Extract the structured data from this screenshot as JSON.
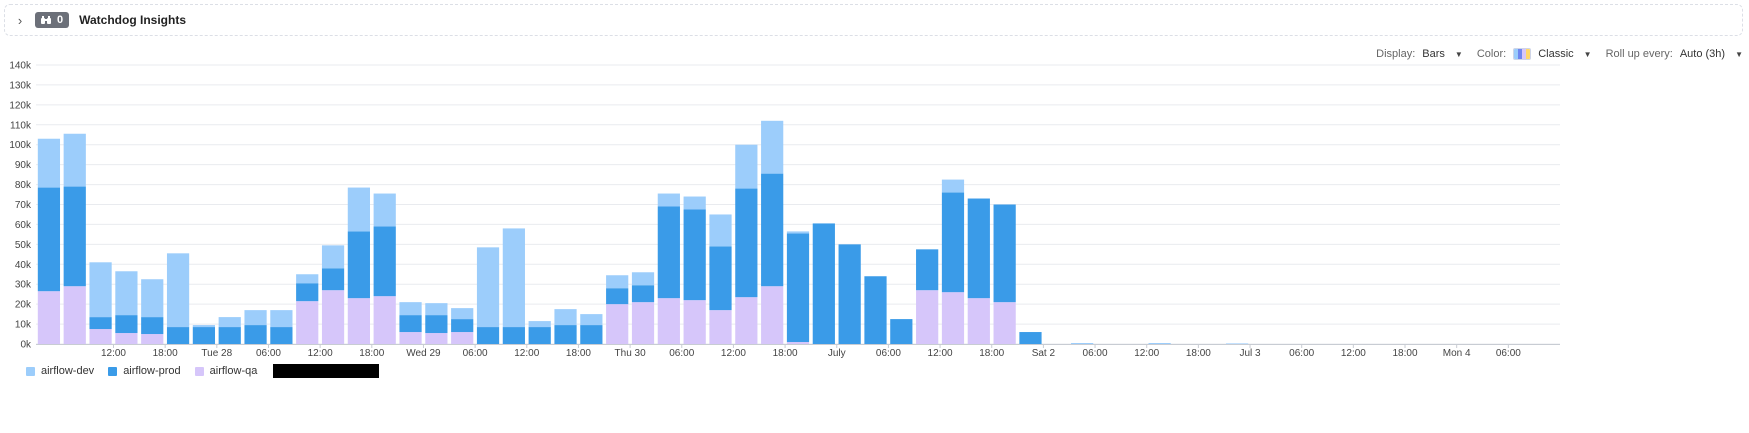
{
  "insights": {
    "count": "0",
    "title": "Watchdog Insights"
  },
  "controls": {
    "display_label": "Display:",
    "display_value": "Bars",
    "color_label": "Color:",
    "color_value": "Classic",
    "rollup_label": "Roll up every:",
    "rollup_value": "Auto (3h)"
  },
  "colors": {
    "airflow-dev": "#9ccdfb",
    "airflow-prod": "#3a9be8",
    "airflow-qa": "#d6c6fa"
  },
  "chart_data": {
    "type": "bar",
    "stacked": true,
    "ylim": [
      0,
      140000
    ],
    "yticks": [
      0,
      10000,
      20000,
      30000,
      40000,
      50000,
      60000,
      70000,
      80000,
      90000,
      100000,
      110000,
      120000,
      130000,
      140000
    ],
    "ytick_labels": [
      "0k",
      "10k",
      "20k",
      "30k",
      "40k",
      "50k",
      "60k",
      "70k",
      "80k",
      "90k",
      "100k",
      "110k",
      "120k",
      "130k",
      "140k"
    ],
    "xlim": [
      "Jun 27 03:00",
      "Jul 4 12:00"
    ],
    "xticks": [
      {
        "x": "Jun 27 12:00",
        "label": "12:00"
      },
      {
        "x": "Jun 27 18:00",
        "label": "18:00"
      },
      {
        "x": "Jun 28 00:00",
        "label": "Tue 28"
      },
      {
        "x": "Jun 28 06:00",
        "label": "06:00"
      },
      {
        "x": "Jun 28 12:00",
        "label": "12:00"
      },
      {
        "x": "Jun 28 18:00",
        "label": "18:00"
      },
      {
        "x": "Jun 29 00:00",
        "label": "Wed 29"
      },
      {
        "x": "Jun 29 06:00",
        "label": "06:00"
      },
      {
        "x": "Jun 29 12:00",
        "label": "12:00"
      },
      {
        "x": "Jun 29 18:00",
        "label": "18:00"
      },
      {
        "x": "Jun 30 00:00",
        "label": "Thu 30"
      },
      {
        "x": "Jun 30 06:00",
        "label": "06:00"
      },
      {
        "x": "Jun 30 12:00",
        "label": "12:00"
      },
      {
        "x": "Jun 30 18:00",
        "label": "18:00"
      },
      {
        "x": "Jul 1 00:00",
        "label": "July"
      },
      {
        "x": "Jul 1 06:00",
        "label": "06:00"
      },
      {
        "x": "Jul 1 12:00",
        "label": "12:00"
      },
      {
        "x": "Jul 1 18:00",
        "label": "18:00"
      },
      {
        "x": "Jul 2 00:00",
        "label": "Sat 2"
      },
      {
        "x": "Jul 2 06:00",
        "label": "06:00"
      },
      {
        "x": "Jul 2 12:00",
        "label": "12:00"
      },
      {
        "x": "Jul 2 18:00",
        "label": "18:00"
      },
      {
        "x": "Jul 3 00:00",
        "label": "Jul 3"
      },
      {
        "x": "Jul 3 06:00",
        "label": "06:00"
      },
      {
        "x": "Jul 3 12:00",
        "label": "12:00"
      },
      {
        "x": "Jul 3 18:00",
        "label": "18:00"
      },
      {
        "x": "Jul 4 00:00",
        "label": "Mon 4"
      },
      {
        "x": "Jul 4 06:00",
        "label": "06:00"
      }
    ],
    "categories": [
      "Jun 27 03:00",
      "Jun 27 06:00",
      "Jun 27 09:00",
      "Jun 27 12:00",
      "Jun 27 15:00",
      "Jun 27 18:00",
      "Jun 27 21:00",
      "Jun 28 00:00",
      "Jun 28 03:00",
      "Jun 28 06:00",
      "Jun 28 09:00",
      "Jun 28 12:00",
      "Jun 28 15:00",
      "Jun 28 18:00",
      "Jun 28 21:00",
      "Jun 29 00:00",
      "Jun 29 03:00",
      "Jun 29 06:00",
      "Jun 29 09:00",
      "Jun 29 12:00",
      "Jun 29 15:00",
      "Jun 29 18:00",
      "Jun 29 21:00",
      "Jun 30 00:00",
      "Jun 30 03:00",
      "Jun 30 06:00",
      "Jun 30 09:00",
      "Jun 30 12:00",
      "Jun 30 15:00",
      "Jun 30 18:00",
      "Jun 30 21:00",
      "Jul 1 00:00",
      "Jul 1 03:00",
      "Jul 1 06:00",
      "Jul 1 09:00",
      "Jul 1 12:00",
      "Jul 1 15:00",
      "Jul 1 18:00",
      "Jul 1 21:00",
      "Jul 2 00:00",
      "Jul 2 03:00",
      "Jul 2 06:00",
      "Jul 2 09:00",
      "Jul 2 12:00",
      "Jul 2 15:00",
      "Jul 2 18:00",
      "Jul 2 21:00",
      "Jul 3 00:00",
      "Jul 3 03:00",
      "Jul 3 06:00",
      "Jul 3 09:00",
      "Jul 3 12:00",
      "Jul 3 15:00",
      "Jul 3 18:00",
      "Jul 3 21:00",
      "Jul 4 00:00",
      "Jul 4 03:00",
      "Jul 4 06:00",
      "Jul 4 09:00"
    ],
    "series": [
      {
        "name": "airflow-qa",
        "values": [
          26500,
          29000,
          7500,
          5500,
          5000,
          0,
          0,
          0,
          0,
          0,
          21500,
          27000,
          23000,
          24000,
          6000,
          5500,
          6000,
          0,
          0,
          0,
          0,
          0,
          20000,
          21000,
          23000,
          22000,
          17000,
          23500,
          29000,
          1000,
          0,
          0,
          0,
          0,
          27000,
          26000,
          23000,
          21000,
          0,
          0,
          0,
          0,
          0,
          0,
          0,
          0,
          0,
          0,
          0,
          0,
          0,
          0,
          0,
          0,
          0,
          0,
          0,
          0,
          0,
          0,
          0,
          0,
          0,
          1500
        ]
      },
      {
        "name": "airflow-prod",
        "values": [
          52000,
          50000,
          6000,
          9000,
          8500,
          8500,
          8500,
          8500,
          9500,
          8500,
          9000,
          11000,
          33500,
          35000,
          8500,
          9000,
          6500,
          8500,
          8500,
          8500,
          9500,
          9500,
          8000,
          8500,
          46000,
          45500,
          32000,
          54500,
          56500,
          54500,
          60500,
          50000,
          34000,
          12500,
          20500,
          50000,
          50000,
          49000,
          6000,
          0,
          0,
          0,
          0,
          0,
          0,
          0,
          0,
          0,
          0,
          0,
          0,
          0,
          0,
          0,
          0,
          0,
          0,
          0,
          0,
          0,
          0,
          0,
          0,
          0,
          0
        ]
      },
      {
        "name": "airflow-dev",
        "values": [
          24500,
          26500,
          27500,
          22000,
          19000,
          37000,
          1000,
          5000,
          7500,
          8500,
          4500,
          11500,
          22000,
          16500,
          6500,
          6000,
          5500,
          40000,
          49500,
          3000,
          8000,
          5500,
          6500,
          6500,
          6500,
          6500,
          16000,
          22000,
          26500,
          1000,
          0,
          0,
          0,
          0,
          0,
          6500,
          0,
          0,
          0,
          0,
          500,
          0,
          0,
          500,
          0,
          0,
          300,
          0,
          0,
          0,
          0,
          0,
          0,
          0,
          0,
          0,
          0,
          0,
          0,
          0,
          0,
          0
        ]
      }
    ],
    "legend": [
      "airflow-dev",
      "airflow-prod",
      "airflow-qa"
    ],
    "grid": true
  }
}
